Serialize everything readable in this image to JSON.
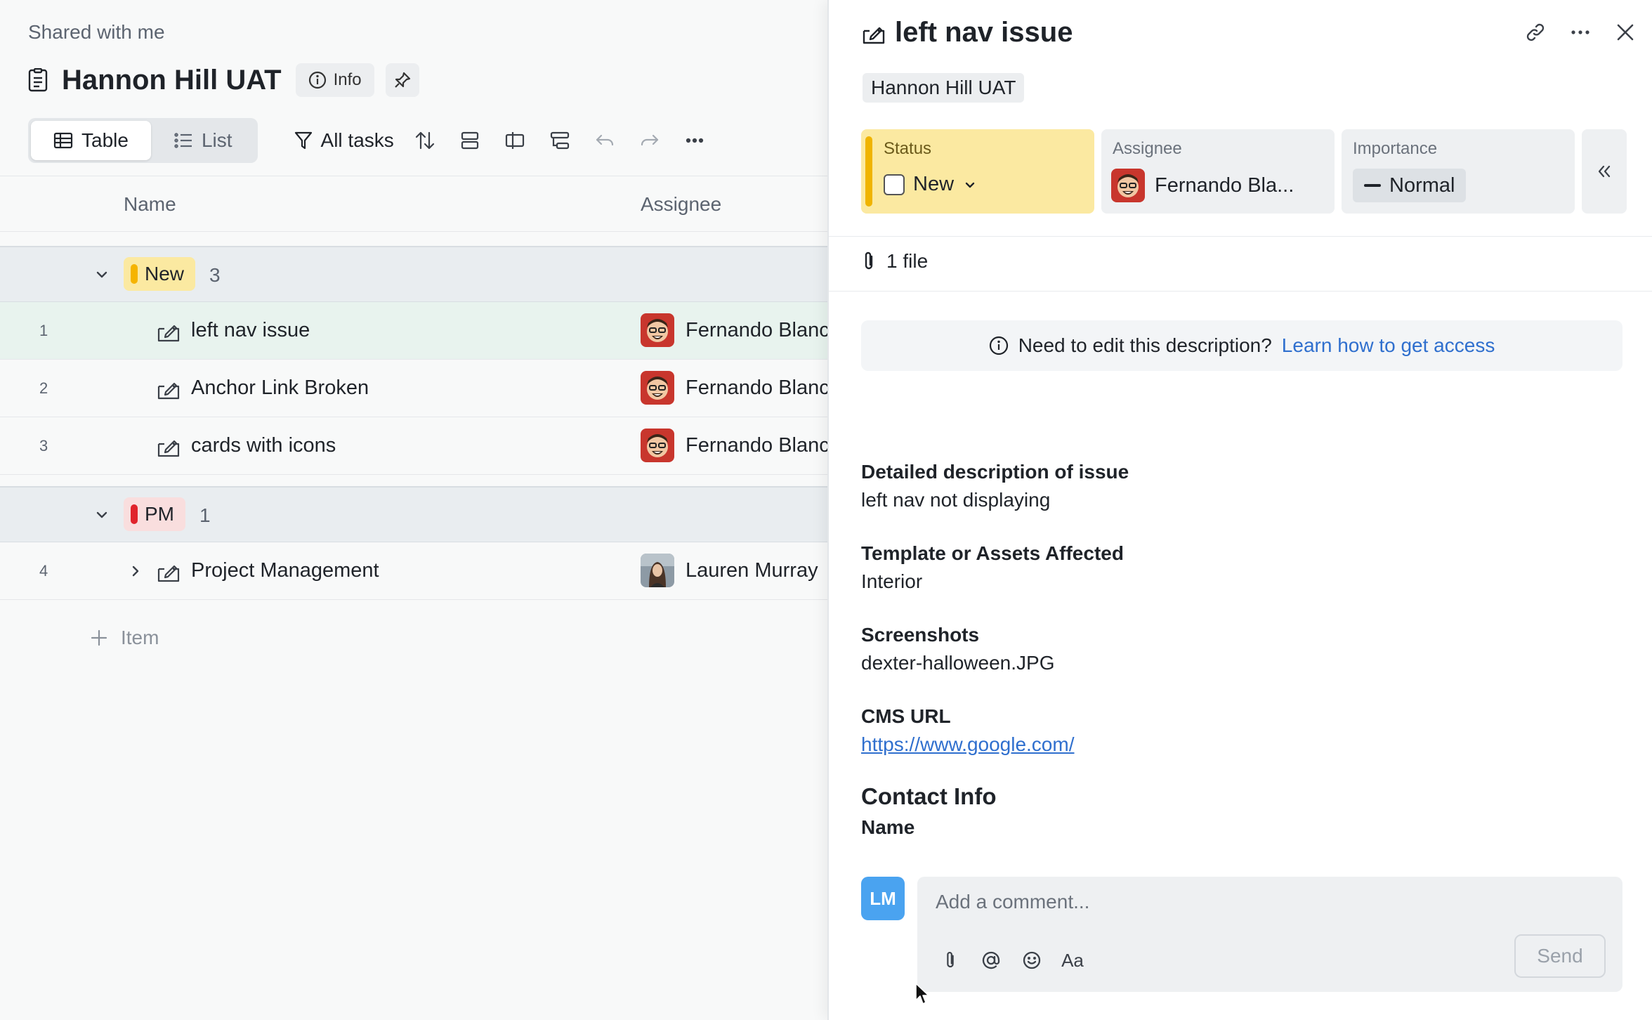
{
  "breadcrumb": "Shared with me",
  "page": {
    "title": "Hannon Hill UAT",
    "info_label": "Info"
  },
  "toolbar": {
    "views": [
      {
        "label": "Table",
        "icon": "table-icon",
        "active": true
      },
      {
        "label": "List",
        "icon": "list-icon",
        "active": false
      }
    ],
    "filter_label": "All tasks"
  },
  "table": {
    "columns": {
      "name": "Name",
      "assignee": "Assignee"
    },
    "groups": [
      {
        "label": "New",
        "count": "3",
        "color": "#f5b400",
        "pill_bg": "#fbe9a1",
        "rows": [
          {
            "num": "1",
            "name": "left nav issue",
            "assignee": "Fernando Blanc",
            "selected": true
          },
          {
            "num": "2",
            "name": "Anchor Link Broken",
            "assignee": "Fernando Blanc",
            "selected": false
          },
          {
            "num": "3",
            "name": "cards with icons",
            "assignee": "Fernando Blanc",
            "selected": false
          }
        ]
      },
      {
        "label": "PM",
        "count": "1",
        "color": "#e0242c",
        "pill_bg": "#f9dede",
        "rows": [
          {
            "num": "4",
            "name": "Project Management",
            "assignee": "Lauren Murray",
            "selected": false
          }
        ]
      }
    ],
    "add_item_label": "Item"
  },
  "detail": {
    "title": "left nav issue",
    "project_tag": "Hannon Hill UAT",
    "fields": {
      "status": {
        "label": "Status",
        "value": "New"
      },
      "assignee": {
        "label": "Assignee",
        "value": "Fernando Bla..."
      },
      "importance": {
        "label": "Importance",
        "value": "Normal"
      }
    },
    "files": "1 file",
    "notice": {
      "text": "Need to edit this description?",
      "link": "Learn how to get access"
    },
    "description": {
      "detailed_heading": "Detailed description of issue",
      "detailed_text": "left nav not displaying",
      "template_heading": "Template or Assets Affected",
      "template_text": "Interior",
      "screenshots_heading": "Screenshots",
      "screenshots_text": "dexter-halloween.JPG",
      "cms_heading": "CMS URL",
      "cms_link": "https://www.google.com/",
      "contact_heading": "Contact Info",
      "name_heading": "Name"
    },
    "comment": {
      "avatar_initials": "LM",
      "placeholder": "Add a comment...",
      "format_label": "Aa",
      "send_label": "Send"
    }
  },
  "colors": {
    "accent": "#2f6fce",
    "status_new": "#f5b400",
    "status_pm": "#e0242c",
    "selected_row": "#e8f3ee"
  }
}
